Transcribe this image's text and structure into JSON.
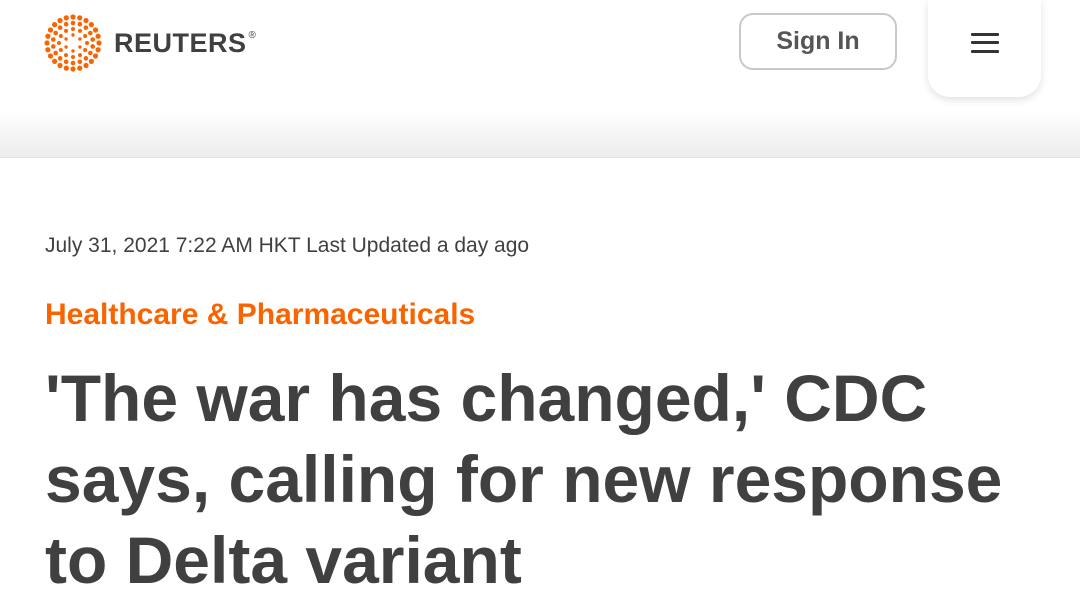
{
  "header": {
    "brand": "REUTERS",
    "brand_mark": "®",
    "logo_icon": "reuters-dot-circle-icon",
    "signin_label": "Sign In",
    "menu_icon": "hamburger-menu-icon"
  },
  "article": {
    "dateline": "July 31, 2021 7:22 AM HKT Last Updated a day ago",
    "category": "Healthcare & Pharmaceuticals",
    "headline": "'The war has changed,' CDC says, calling for new response to Delta variant"
  },
  "colors": {
    "accent": "#fa6400",
    "text": "#404040"
  }
}
